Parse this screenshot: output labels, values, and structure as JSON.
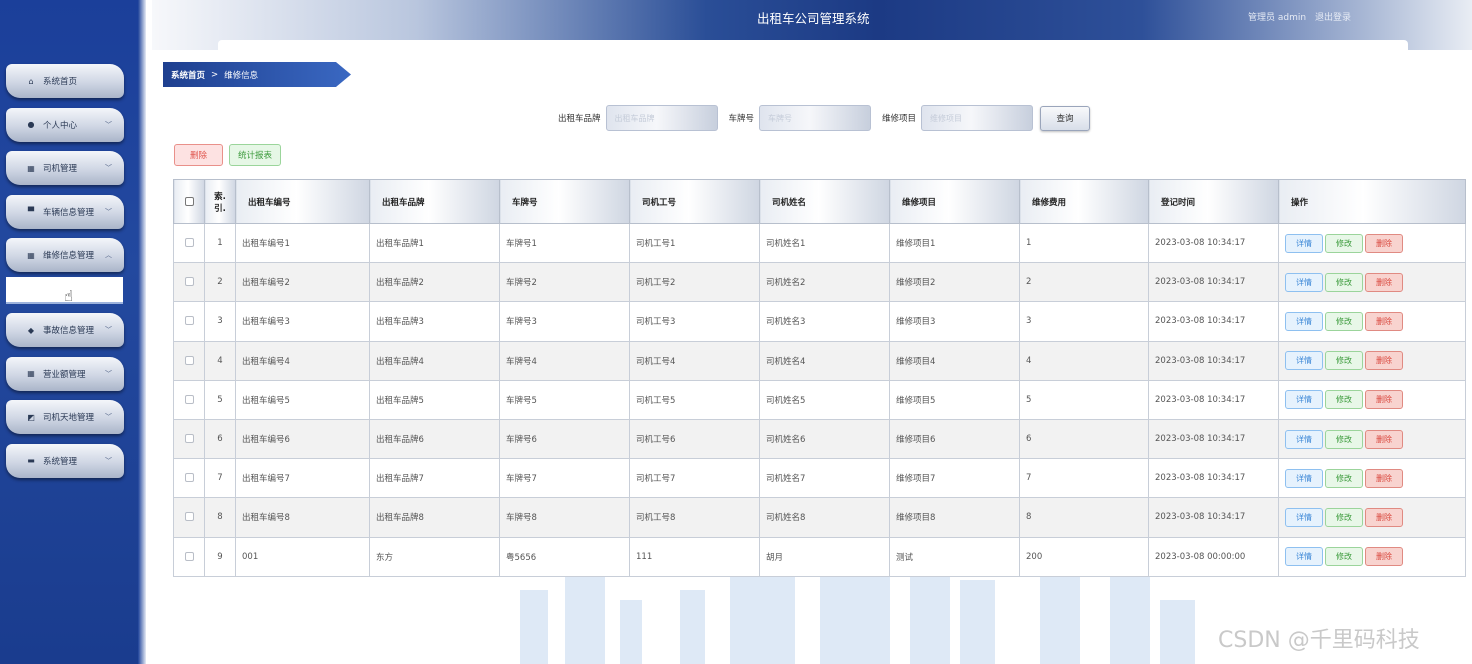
{
  "header": {
    "title": "出租车公司管理系统",
    "user_label": "管理员 admin",
    "logout_label": "退出登录"
  },
  "sidebar": {
    "items": [
      {
        "label": "系统首页",
        "icon": "home-icon",
        "glyph": "⌂",
        "chevron": ""
      },
      {
        "label": "个人中心",
        "icon": "user-icon",
        "glyph": "●",
        "chevron": "﹀"
      },
      {
        "label": "司机管理",
        "icon": "grid-icon",
        "glyph": "▦",
        "chevron": "﹀"
      },
      {
        "label": "车辆信息管理",
        "icon": "monitor-icon",
        "glyph": "▀",
        "chevron": "﹀"
      },
      {
        "label": "维修信息管理",
        "icon": "grid-icon",
        "glyph": "▦",
        "chevron": "︿"
      },
      {
        "label": "事故信息管理",
        "icon": "location-icon",
        "glyph": "◆",
        "chevron": "﹀"
      },
      {
        "label": "营业额管理",
        "icon": "grid-icon",
        "glyph": "▦",
        "chevron": "﹀"
      },
      {
        "label": "司机天地管理",
        "icon": "chart-icon",
        "glyph": "◩",
        "chevron": "﹀"
      },
      {
        "label": "系统管理",
        "icon": "briefcase-icon",
        "glyph": "▬",
        "chevron": "﹀"
      }
    ]
  },
  "breadcrumb": {
    "home": "系统首页",
    "separator": ">",
    "current": "维修信息"
  },
  "search": {
    "brand_label": "出租车品牌",
    "brand_placeholder": "出租车品牌",
    "plate_label": "车牌号",
    "plate_placeholder": "车牌号",
    "item_label": "维修项目",
    "item_placeholder": "维修项目",
    "query_button": "查询"
  },
  "actions": {
    "delete_label": "删除",
    "report_label": "统计报表"
  },
  "table": {
    "columns": [
      "索引",
      "出租车编号",
      "出租车品牌",
      "车牌号",
      "司机工号",
      "司机姓名",
      "维修项目",
      "维修费用",
      "登记时间",
      "操作"
    ],
    "index_header_line1": "索.",
    "index_header_line2": "引.",
    "op_labels": {
      "detail": "详情",
      "edit": "修改",
      "delete": "删除"
    },
    "rows": [
      [
        "1",
        "出租车编号1",
        "出租车品牌1",
        "车牌号1",
        "司机工号1",
        "司机姓名1",
        "维修项目1",
        "1",
        "2023-03-08 10:34:17"
      ],
      [
        "2",
        "出租车编号2",
        "出租车品牌2",
        "车牌号2",
        "司机工号2",
        "司机姓名2",
        "维修项目2",
        "2",
        "2023-03-08 10:34:17"
      ],
      [
        "3",
        "出租车编号3",
        "出租车品牌3",
        "车牌号3",
        "司机工号3",
        "司机姓名3",
        "维修项目3",
        "3",
        "2023-03-08 10:34:17"
      ],
      [
        "4",
        "出租车编号4",
        "出租车品牌4",
        "车牌号4",
        "司机工号4",
        "司机姓名4",
        "维修项目4",
        "4",
        "2023-03-08 10:34:17"
      ],
      [
        "5",
        "出租车编号5",
        "出租车品牌5",
        "车牌号5",
        "司机工号5",
        "司机姓名5",
        "维修项目5",
        "5",
        "2023-03-08 10:34:17"
      ],
      [
        "6",
        "出租车编号6",
        "出租车品牌6",
        "车牌号6",
        "司机工号6",
        "司机姓名6",
        "维修项目6",
        "6",
        "2023-03-08 10:34:17"
      ],
      [
        "7",
        "出租车编号7",
        "出租车品牌7",
        "车牌号7",
        "司机工号7",
        "司机姓名7",
        "维修项目7",
        "7",
        "2023-03-08 10:34:17"
      ],
      [
        "8",
        "出租车编号8",
        "出租车品牌8",
        "车牌号8",
        "司机工号8",
        "司机姓名8",
        "维修项目8",
        "8",
        "2023-03-08 10:34:17"
      ],
      [
        "9",
        "001",
        "东方",
        "粤5656",
        "111",
        "胡月",
        "测试",
        "200",
        "2023-03-08 00:00:00"
      ]
    ]
  },
  "watermark": "CSDN @千里码科技",
  "colors": {
    "sidebar": "#1b3f9a",
    "header_mid": "#1c3a84",
    "delete": "#e0564e",
    "report": "#3c9a3c",
    "detail": "#3a86d6"
  }
}
